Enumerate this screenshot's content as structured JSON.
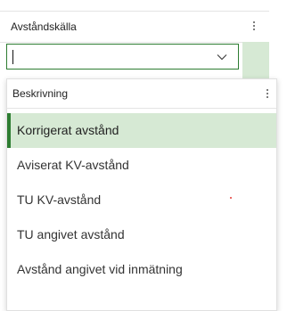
{
  "column_header": {
    "title": "Avståndskälla"
  },
  "combo": {
    "value": "",
    "placeholder": ""
  },
  "dropdown": {
    "header_title": "Beskrivning",
    "items": [
      {
        "label": "Korrigerat avstånd",
        "selected": true
      },
      {
        "label": "Aviserat KV-avstånd",
        "selected": false
      },
      {
        "label": "TU KV-avstånd",
        "selected": false
      },
      {
        "label": "TU angivet avstånd",
        "selected": false
      },
      {
        "label": "Avstånd angivet vid inmätning",
        "selected": false
      }
    ]
  },
  "icons": {
    "header_menu": "more-vertical-icon",
    "combo_chevron": "chevron-down-icon"
  },
  "colors": {
    "accent_green": "#2e7d32",
    "selected_bg": "#d6e9d4"
  }
}
